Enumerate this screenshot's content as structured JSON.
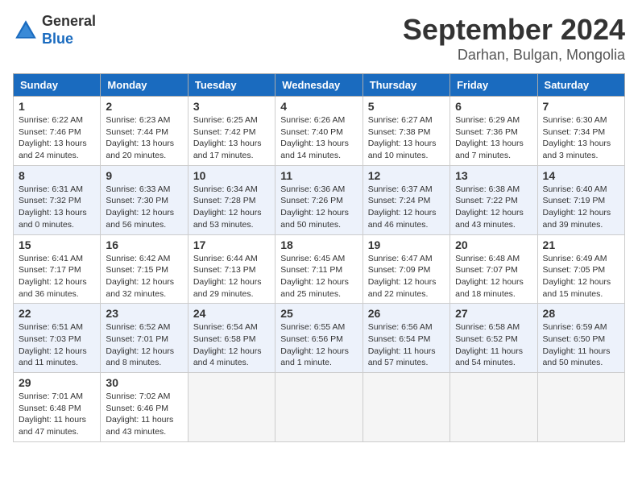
{
  "header": {
    "logo_general": "General",
    "logo_blue": "Blue",
    "month_title": "September 2024",
    "location": "Darhan, Bulgan, Mongolia"
  },
  "columns": [
    "Sunday",
    "Monday",
    "Tuesday",
    "Wednesday",
    "Thursday",
    "Friday",
    "Saturday"
  ],
  "weeks": [
    [
      {
        "day": "1",
        "sunrise": "Sunrise: 6:22 AM",
        "sunset": "Sunset: 7:46 PM",
        "daylight": "Daylight: 13 hours and 24 minutes."
      },
      {
        "day": "2",
        "sunrise": "Sunrise: 6:23 AM",
        "sunset": "Sunset: 7:44 PM",
        "daylight": "Daylight: 13 hours and 20 minutes."
      },
      {
        "day": "3",
        "sunrise": "Sunrise: 6:25 AM",
        "sunset": "Sunset: 7:42 PM",
        "daylight": "Daylight: 13 hours and 17 minutes."
      },
      {
        "day": "4",
        "sunrise": "Sunrise: 6:26 AM",
        "sunset": "Sunset: 7:40 PM",
        "daylight": "Daylight: 13 hours and 14 minutes."
      },
      {
        "day": "5",
        "sunrise": "Sunrise: 6:27 AM",
        "sunset": "Sunset: 7:38 PM",
        "daylight": "Daylight: 13 hours and 10 minutes."
      },
      {
        "day": "6",
        "sunrise": "Sunrise: 6:29 AM",
        "sunset": "Sunset: 7:36 PM",
        "daylight": "Daylight: 13 hours and 7 minutes."
      },
      {
        "day": "7",
        "sunrise": "Sunrise: 6:30 AM",
        "sunset": "Sunset: 7:34 PM",
        "daylight": "Daylight: 13 hours and 3 minutes."
      }
    ],
    [
      {
        "day": "8",
        "sunrise": "Sunrise: 6:31 AM",
        "sunset": "Sunset: 7:32 PM",
        "daylight": "Daylight: 13 hours and 0 minutes."
      },
      {
        "day": "9",
        "sunrise": "Sunrise: 6:33 AM",
        "sunset": "Sunset: 7:30 PM",
        "daylight": "Daylight: 12 hours and 56 minutes."
      },
      {
        "day": "10",
        "sunrise": "Sunrise: 6:34 AM",
        "sunset": "Sunset: 7:28 PM",
        "daylight": "Daylight: 12 hours and 53 minutes."
      },
      {
        "day": "11",
        "sunrise": "Sunrise: 6:36 AM",
        "sunset": "Sunset: 7:26 PM",
        "daylight": "Daylight: 12 hours and 50 minutes."
      },
      {
        "day": "12",
        "sunrise": "Sunrise: 6:37 AM",
        "sunset": "Sunset: 7:24 PM",
        "daylight": "Daylight: 12 hours and 46 minutes."
      },
      {
        "day": "13",
        "sunrise": "Sunrise: 6:38 AM",
        "sunset": "Sunset: 7:22 PM",
        "daylight": "Daylight: 12 hours and 43 minutes."
      },
      {
        "day": "14",
        "sunrise": "Sunrise: 6:40 AM",
        "sunset": "Sunset: 7:19 PM",
        "daylight": "Daylight: 12 hours and 39 minutes."
      }
    ],
    [
      {
        "day": "15",
        "sunrise": "Sunrise: 6:41 AM",
        "sunset": "Sunset: 7:17 PM",
        "daylight": "Daylight: 12 hours and 36 minutes."
      },
      {
        "day": "16",
        "sunrise": "Sunrise: 6:42 AM",
        "sunset": "Sunset: 7:15 PM",
        "daylight": "Daylight: 12 hours and 32 minutes."
      },
      {
        "day": "17",
        "sunrise": "Sunrise: 6:44 AM",
        "sunset": "Sunset: 7:13 PM",
        "daylight": "Daylight: 12 hours and 29 minutes."
      },
      {
        "day": "18",
        "sunrise": "Sunrise: 6:45 AM",
        "sunset": "Sunset: 7:11 PM",
        "daylight": "Daylight: 12 hours and 25 minutes."
      },
      {
        "day": "19",
        "sunrise": "Sunrise: 6:47 AM",
        "sunset": "Sunset: 7:09 PM",
        "daylight": "Daylight: 12 hours and 22 minutes."
      },
      {
        "day": "20",
        "sunrise": "Sunrise: 6:48 AM",
        "sunset": "Sunset: 7:07 PM",
        "daylight": "Daylight: 12 hours and 18 minutes."
      },
      {
        "day": "21",
        "sunrise": "Sunrise: 6:49 AM",
        "sunset": "Sunset: 7:05 PM",
        "daylight": "Daylight: 12 hours and 15 minutes."
      }
    ],
    [
      {
        "day": "22",
        "sunrise": "Sunrise: 6:51 AM",
        "sunset": "Sunset: 7:03 PM",
        "daylight": "Daylight: 12 hours and 11 minutes."
      },
      {
        "day": "23",
        "sunrise": "Sunrise: 6:52 AM",
        "sunset": "Sunset: 7:01 PM",
        "daylight": "Daylight: 12 hours and 8 minutes."
      },
      {
        "day": "24",
        "sunrise": "Sunrise: 6:54 AM",
        "sunset": "Sunset: 6:58 PM",
        "daylight": "Daylight: 12 hours and 4 minutes."
      },
      {
        "day": "25",
        "sunrise": "Sunrise: 6:55 AM",
        "sunset": "Sunset: 6:56 PM",
        "daylight": "Daylight: 12 hours and 1 minute."
      },
      {
        "day": "26",
        "sunrise": "Sunrise: 6:56 AM",
        "sunset": "Sunset: 6:54 PM",
        "daylight": "Daylight: 11 hours and 57 minutes."
      },
      {
        "day": "27",
        "sunrise": "Sunrise: 6:58 AM",
        "sunset": "Sunset: 6:52 PM",
        "daylight": "Daylight: 11 hours and 54 minutes."
      },
      {
        "day": "28",
        "sunrise": "Sunrise: 6:59 AM",
        "sunset": "Sunset: 6:50 PM",
        "daylight": "Daylight: 11 hours and 50 minutes."
      }
    ],
    [
      {
        "day": "29",
        "sunrise": "Sunrise: 7:01 AM",
        "sunset": "Sunset: 6:48 PM",
        "daylight": "Daylight: 11 hours and 47 minutes."
      },
      {
        "day": "30",
        "sunrise": "Sunrise: 7:02 AM",
        "sunset": "Sunset: 6:46 PM",
        "daylight": "Daylight: 11 hours and 43 minutes."
      },
      null,
      null,
      null,
      null,
      null
    ]
  ]
}
